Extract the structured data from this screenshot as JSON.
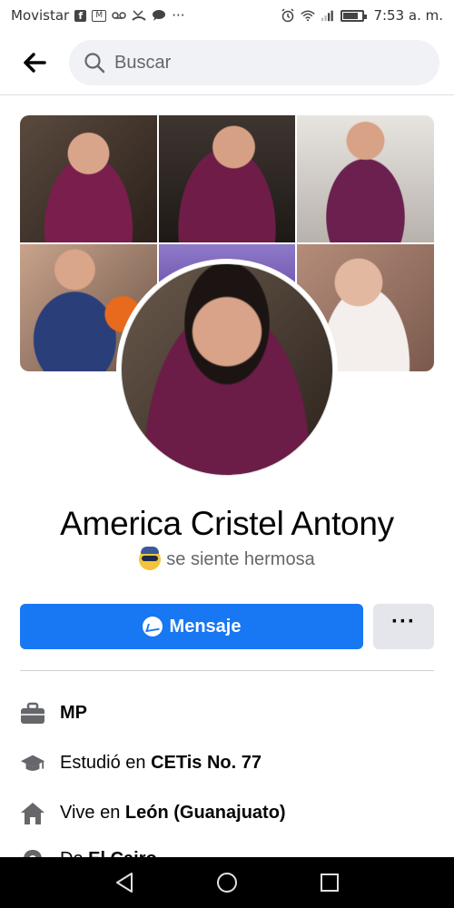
{
  "status_bar": {
    "carrier": "Movistar",
    "ellipsis": "···",
    "time": "7:53 a. m."
  },
  "header": {
    "search_placeholder": "Buscar"
  },
  "profile": {
    "name": "America Cristel Antony",
    "feeling": "se siente hermosa"
  },
  "actions": {
    "message_label": "Mensaje",
    "more_label": "···"
  },
  "details": [
    {
      "prefix": "",
      "value": "MP",
      "icon": "briefcase-icon"
    },
    {
      "prefix": "Estudió en ",
      "value": "CETis No. 77",
      "icon": "graduation-cap-icon"
    },
    {
      "prefix": "Vive en ",
      "value": "León (Guanajuato)",
      "icon": "home-icon"
    },
    {
      "prefix": "De ",
      "value": "El Cairo",
      "icon": "location-pin-icon"
    }
  ],
  "colors": {
    "accent": "#1877f2",
    "secondary_button": "#e4e6eb",
    "text": "#050505",
    "muted": "#65676b"
  }
}
